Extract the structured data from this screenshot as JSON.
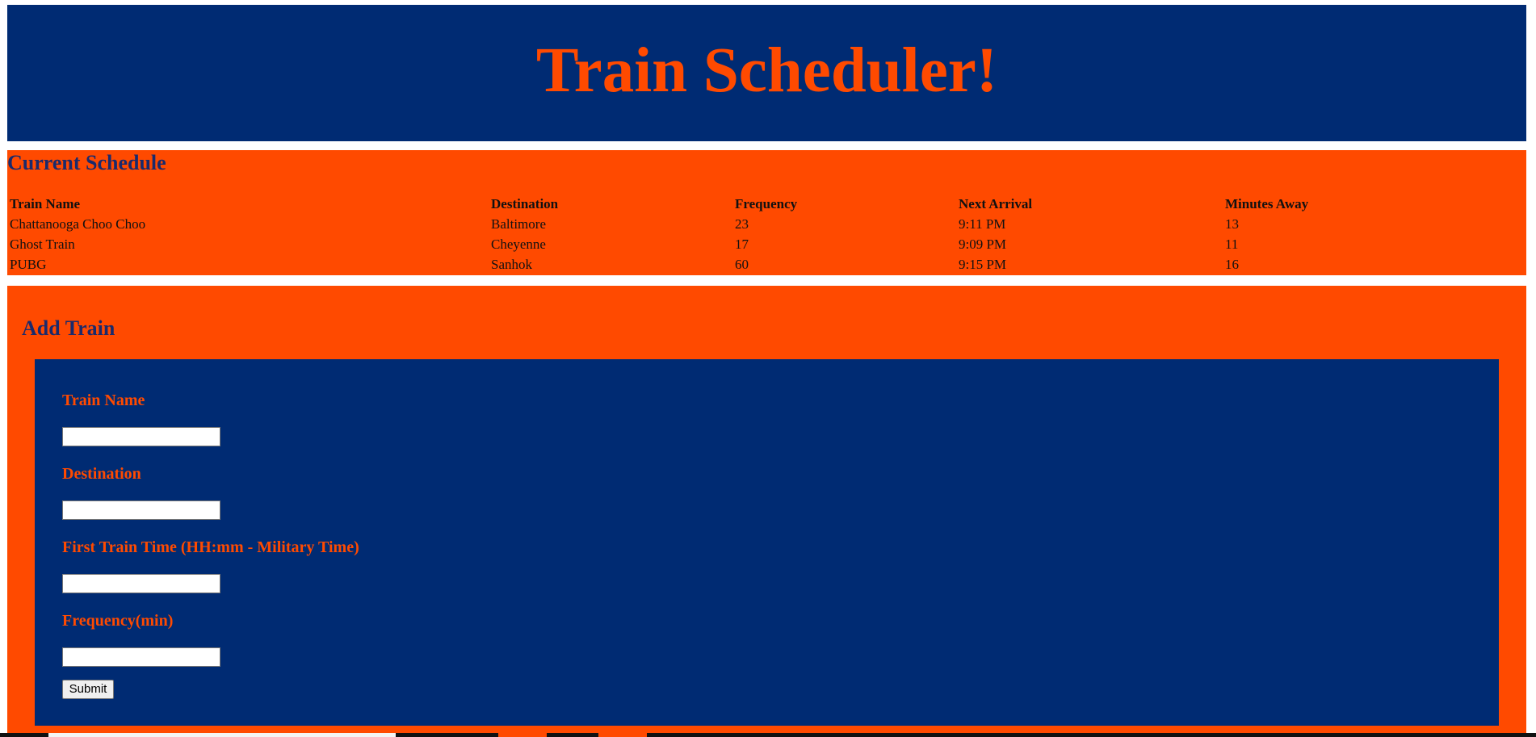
{
  "header": {
    "title": "Train Scheduler!"
  },
  "schedule": {
    "title": "Current Schedule",
    "columns": [
      "Train Name",
      "Destination",
      "Frequency",
      "Next Arrival",
      "Minutes Away"
    ],
    "rows": [
      [
        "Chattanooga Choo Choo",
        "Baltimore",
        "23",
        "9:11 PM",
        "13"
      ],
      [
        "Ghost Train",
        "Cheyenne",
        "17",
        "9:09 PM",
        "11"
      ],
      [
        "PUBG",
        "Sanhok",
        "60",
        "9:15 PM",
        "16"
      ]
    ]
  },
  "add_train": {
    "title": "Add Train",
    "fields": {
      "train_name": {
        "label": "Train Name",
        "value": ""
      },
      "destination": {
        "label": "Destination",
        "value": ""
      },
      "first_time": {
        "label": "First Train Time (HH:mm - Military Time)",
        "value": ""
      },
      "frequency": {
        "label": "Frequency(min)",
        "value": ""
      }
    },
    "submit_label": "Submit"
  },
  "colors": {
    "navy": "#002b73",
    "orange": "#ff4a00",
    "heading_navy": "#1a2a6c"
  }
}
